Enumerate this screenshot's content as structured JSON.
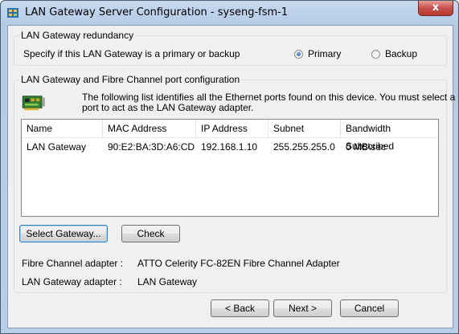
{
  "window": {
    "title": "LAN Gateway Server Configuration - syseng-fsm-1",
    "close_glyph": "x"
  },
  "redundancy": {
    "group_label": "LAN Gateway redundancy",
    "prompt": "Specify if this LAN Gateway is a primary or backup",
    "options": [
      {
        "label": "Primary",
        "selected": true
      },
      {
        "label": "Backup",
        "selected": false
      }
    ]
  },
  "port_config": {
    "group_label": "LAN Gateway and Fibre Channel port configuration",
    "description_line1": "The following list identifies all the Ethernet ports found on this device. You must select a",
    "description_line2": "port to act as the LAN Gateway adapter.",
    "icon": "network-card-icon",
    "columns": [
      "Name",
      "MAC Address",
      "IP Address",
      "Subnet",
      "Bandwidth Subscribed"
    ],
    "rows": [
      [
        "LAN Gateway",
        "90:E2:BA:3D:A6:CD",
        "192.168.1.10",
        "255.255.255.0",
        "0 MB\\sec"
      ]
    ],
    "select_button": "Select Gateway...",
    "check_button": "Check",
    "fc_adapter_label": "Fibre Channel adapter :",
    "fc_adapter_value": "ATTO Celerity FC-82EN Fibre Channel Adapter",
    "lan_adapter_label": "LAN Gateway adapter :",
    "lan_adapter_value": "LAN Gateway"
  },
  "footer": {
    "back": "< Back",
    "next": "Next >",
    "cancel": "Cancel"
  },
  "colors": {
    "title_bar": "#b9cfe9",
    "close_button": "#c75050",
    "dialog_background": "#f0f0f0",
    "default_button_border": "#3c7fb1"
  }
}
